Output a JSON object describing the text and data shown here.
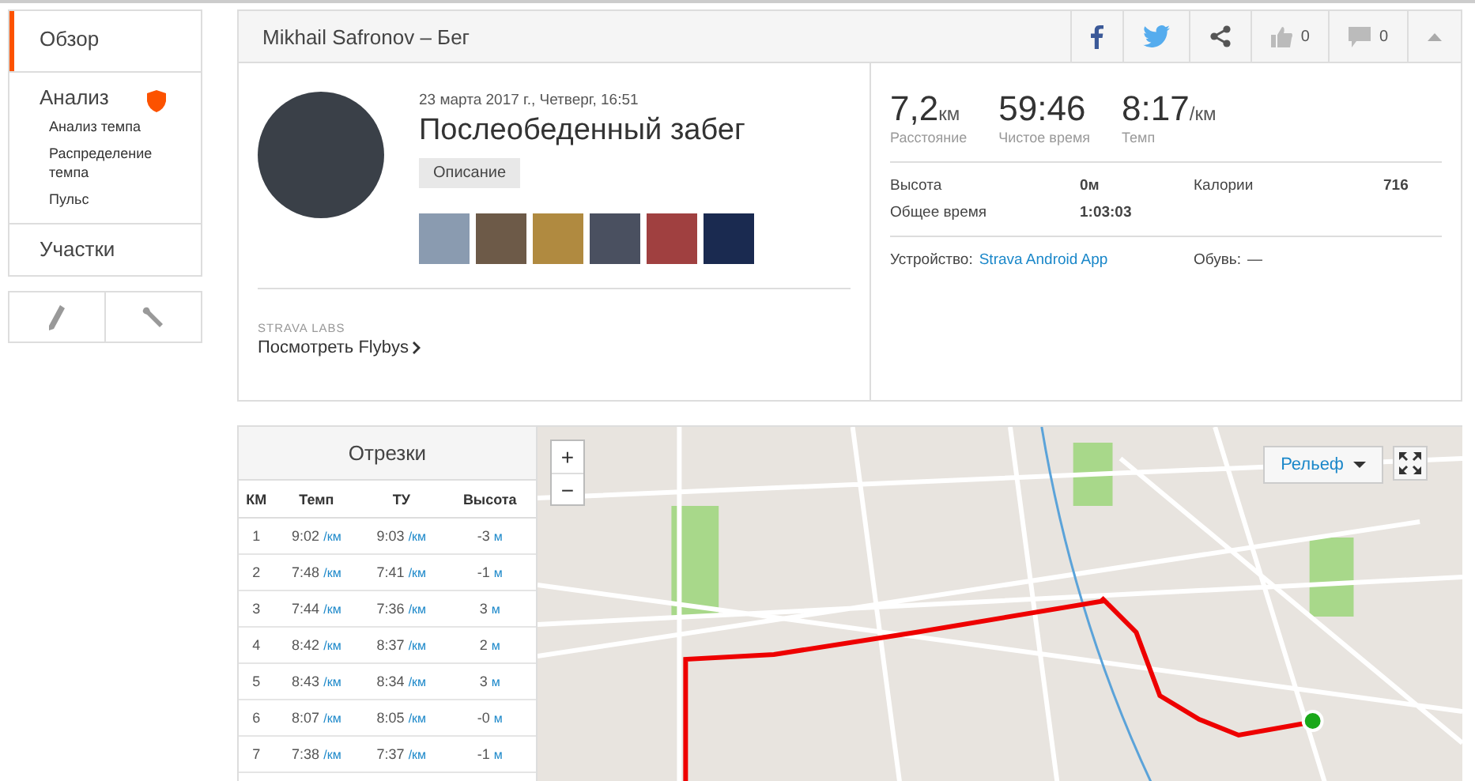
{
  "sidebar": {
    "items": [
      {
        "label": "Обзор",
        "selected": true,
        "badge": false
      },
      {
        "label": "Анализ",
        "selected": false,
        "badge": true,
        "children": [
          {
            "label": "Анализ темпа"
          },
          {
            "label": "Распределение темпа"
          },
          {
            "label": "Пульс"
          }
        ]
      },
      {
        "label": "Участки",
        "selected": false,
        "badge": false
      }
    ]
  },
  "activity": {
    "title": "Mikhail Safronov – Бег",
    "kudos_count": "0",
    "comment_count": "0",
    "date": "23 марта 2017 г., Четверг, 16:51",
    "name": "Послеобеденный забег",
    "description_button": "Описание",
    "photos": [
      {
        "kind": "photo"
      },
      {
        "kind": "photo"
      },
      {
        "kind": "photo"
      },
      {
        "kind": "photo"
      },
      {
        "kind": "photo"
      },
      {
        "kind": "photo"
      }
    ],
    "labs_label": "STRAVA LABS",
    "flybys_link": "Посмотреть Flybys",
    "stats": [
      {
        "value": "7,2",
        "unit": "км",
        "label": "Расстояние"
      },
      {
        "value": "59:46",
        "label": "Чистое время"
      },
      {
        "value": "8:17",
        "unit": "/км",
        "label": "Темп"
      }
    ],
    "details": [
      {
        "label": "Высота",
        "value": "0м"
      },
      {
        "label": "Калории",
        "value": "716"
      },
      {
        "label": "Общее время",
        "value": "1:03:03"
      }
    ],
    "device_label": "Устройство:",
    "device": "Strava Android App",
    "shoes_label": "Обувь:",
    "shoes": "—"
  },
  "splits": {
    "title": "Отрезки",
    "columns": [
      "КМ",
      "Темп",
      "ТУ",
      "Высота"
    ],
    "rows": [
      [
        {
          "value": "1"
        },
        {
          "value": "9:02",
          "unit": "/км"
        },
        {
          "value": "9:03",
          "unit": "/км"
        },
        {
          "value": "-3",
          "unit": "м"
        }
      ],
      [
        {
          "value": "2"
        },
        {
          "value": "7:48",
          "unit": "/км"
        },
        {
          "value": "7:41",
          "unit": "/км"
        },
        {
          "value": "-1",
          "unit": "м"
        }
      ],
      [
        {
          "value": "3"
        },
        {
          "value": "7:44",
          "unit": "/км"
        },
        {
          "value": "7:36",
          "unit": "/км"
        },
        {
          "value": "3",
          "unit": "м"
        }
      ],
      [
        {
          "value": "4"
        },
        {
          "value": "8:42",
          "unit": "/км"
        },
        {
          "value": "8:37",
          "unit": "/км"
        },
        {
          "value": "2",
          "unit": "м"
        }
      ],
      [
        {
          "value": "5"
        },
        {
          "value": "8:43",
          "unit": "/км"
        },
        {
          "value": "8:34",
          "unit": "/км"
        },
        {
          "value": "3",
          "unit": "м"
        }
      ],
      [
        {
          "value": "6"
        },
        {
          "value": "8:07",
          "unit": "/км"
        },
        {
          "value": "8:05",
          "unit": "/км"
        },
        {
          "value": "-0",
          "unit": "м"
        }
      ],
      [
        {
          "value": "7"
        },
        {
          "value": "7:38",
          "unit": "/км"
        },
        {
          "value": "7:37",
          "unit": "/км"
        },
        {
          "value": "-1",
          "unit": "м"
        }
      ]
    ]
  },
  "map": {
    "zoom_in": "+",
    "zoom_out": "−",
    "layer": "Рельеф"
  }
}
